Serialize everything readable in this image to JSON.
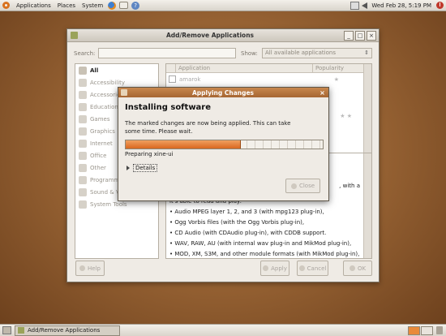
{
  "top_panel": {
    "menus": [
      "Applications",
      "Places",
      "System"
    ],
    "clock": "Wed Feb 28,  5:19 PM"
  },
  "main_window": {
    "title": "Add/Remove Applications",
    "search_label": "Search:",
    "show_label": "Show:",
    "show_value": "All available applications",
    "categories": [
      {
        "label": "All",
        "icon": "all-icon"
      },
      {
        "label": "Accessibility",
        "icon": "accessibility-icon"
      },
      {
        "label": "Accessories",
        "icon": "accessories-icon"
      },
      {
        "label": "Education",
        "icon": "education-icon"
      },
      {
        "label": "Games",
        "icon": "games-icon"
      },
      {
        "label": "Graphics",
        "icon": "graphics-icon"
      },
      {
        "label": "Internet",
        "icon": "internet-icon"
      },
      {
        "label": "Office",
        "icon": "office-icon"
      },
      {
        "label": "Other",
        "icon": "other-icon"
      },
      {
        "label": "Programming",
        "icon": "programming-icon"
      },
      {
        "label": "Sound & Video",
        "icon": "sound-video-icon"
      },
      {
        "label": "System Tools",
        "icon": "system-tools-icon"
      }
    ],
    "columns": {
      "application": "Application",
      "popularity": "Popularity"
    },
    "first_app": "amarok",
    "description": {
      "with_fragment": ", with a",
      "lines": [
        "it's able to read and play:",
        "• Audio MPEG layer 1, 2, and 3 (with mpg123 plug-in),",
        "• Ogg Vorbis files (with the Ogg Vorbis plug-in),",
        "• CD Audio (with CDAudio plug-in), with CDDB support.",
        "• WAV, RAW, AU (with internal wav plug-in and MikMod plug-in),",
        "• MOD, XM, S3M, and other module formats (with MikMod plug-in),"
      ]
    },
    "buttons": {
      "help": "Help",
      "apply": "Apply",
      "cancel": "Cancel",
      "ok": "OK"
    }
  },
  "dialog": {
    "title": "Applying Changes",
    "heading": "Installing software",
    "message": "The marked changes are now being applied. This can take some time. Please wait.",
    "progress_fraction": 0.58,
    "status": "Preparing xine-ui",
    "details_label": "Details",
    "close_label": "Close"
  },
  "bottom_panel": {
    "task_label": "Add/Remove Applications"
  },
  "colors": {
    "accent": "#d9671f",
    "desktop": "#9a6535"
  }
}
